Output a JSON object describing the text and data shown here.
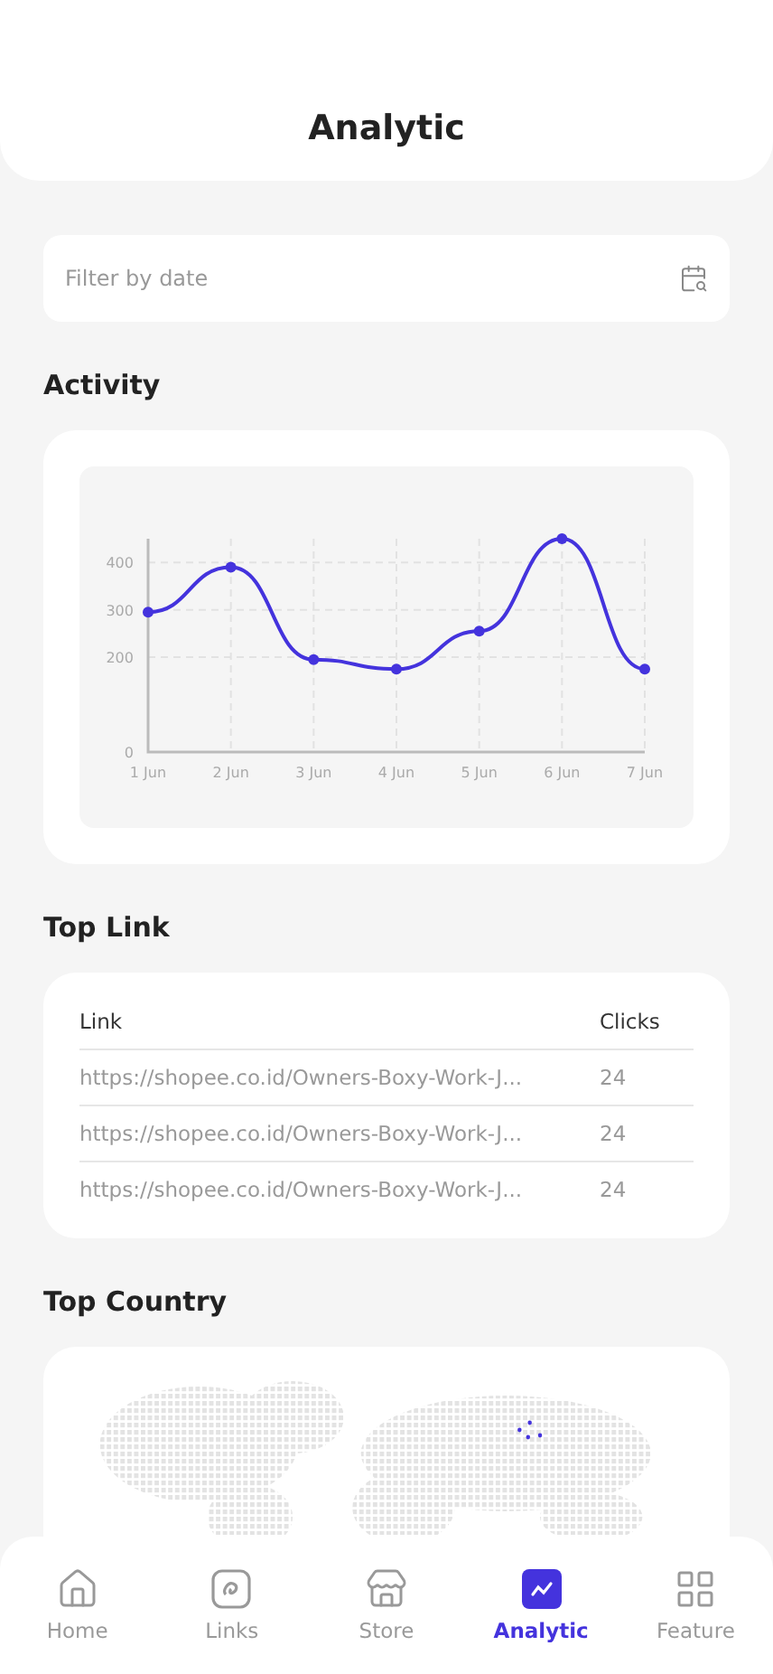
{
  "header": {
    "title": "Analytic"
  },
  "filter": {
    "placeholder": "Filter by date"
  },
  "activity": {
    "title": "Activity",
    "chart_data": {
      "type": "line",
      "categories": [
        "1 Jun",
        "2 Jun",
        "3 Jun",
        "4 Jun",
        "5 Jun",
        "6 Jun",
        "7 Jun"
      ],
      "series": [
        {
          "color": "#4433dd",
          "marker": true,
          "values": [
            295,
            390,
            195,
            175,
            255,
            450,
            175
          ]
        }
      ],
      "ylim": [
        0,
        450
      ],
      "yticks": [
        0,
        200,
        300,
        400
      ],
      "grid": true
    }
  },
  "top_link": {
    "title": "Top Link",
    "columns": [
      "Link",
      "Clicks"
    ],
    "rows": [
      {
        "link": "https://shopee.co.id/Owners-Boxy-Work-J...",
        "clicks": "24"
      },
      {
        "link": "https://shopee.co.id/Owners-Boxy-Work-J...",
        "clicks": "24"
      },
      {
        "link": "https://shopee.co.id/Owners-Boxy-Work-J...",
        "clicks": "24"
      }
    ]
  },
  "top_country": {
    "title": "Top Country"
  },
  "nav": [
    {
      "label": "Home",
      "selected": false
    },
    {
      "label": "Links",
      "selected": false
    },
    {
      "label": "Store",
      "selected": false
    },
    {
      "label": "Analytic",
      "selected": true
    },
    {
      "label": "Feature",
      "selected": false
    }
  ]
}
